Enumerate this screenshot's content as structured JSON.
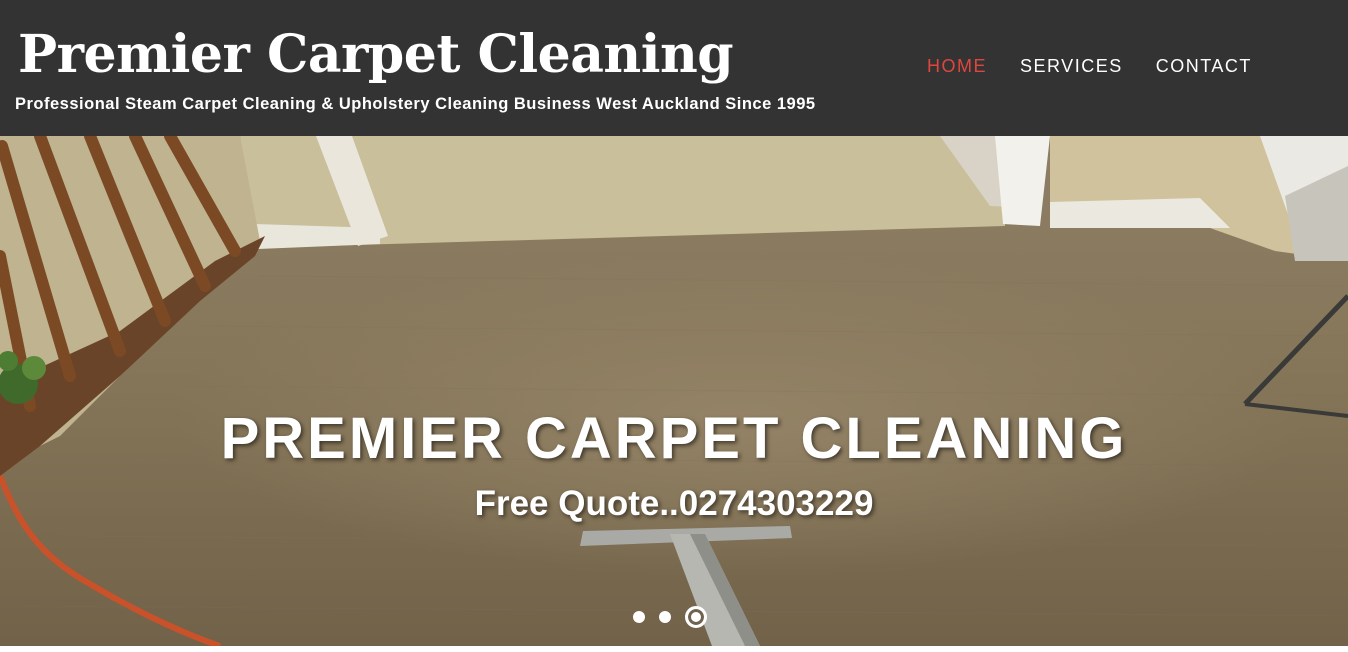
{
  "header": {
    "site_title": "Premier Carpet Cleaning",
    "tagline": "Professional Steam Carpet Cleaning & Upholstery Cleaning Business West Auckland Since 1995",
    "background_color": "#333333"
  },
  "nav": {
    "items": [
      {
        "label": "HOME",
        "active": true
      },
      {
        "label": "SERVICES",
        "active": false
      },
      {
        "label": "CONTACT",
        "active": false
      }
    ],
    "active_color": "#e0463f",
    "text_color": "#ffffff"
  },
  "hero": {
    "title": "PREMIER CARPET CLEANING",
    "subtitle": "Free Quote..0274303229",
    "image_description_icon": "carpet-photo",
    "slides": {
      "count": 3,
      "active_index": 2
    }
  }
}
